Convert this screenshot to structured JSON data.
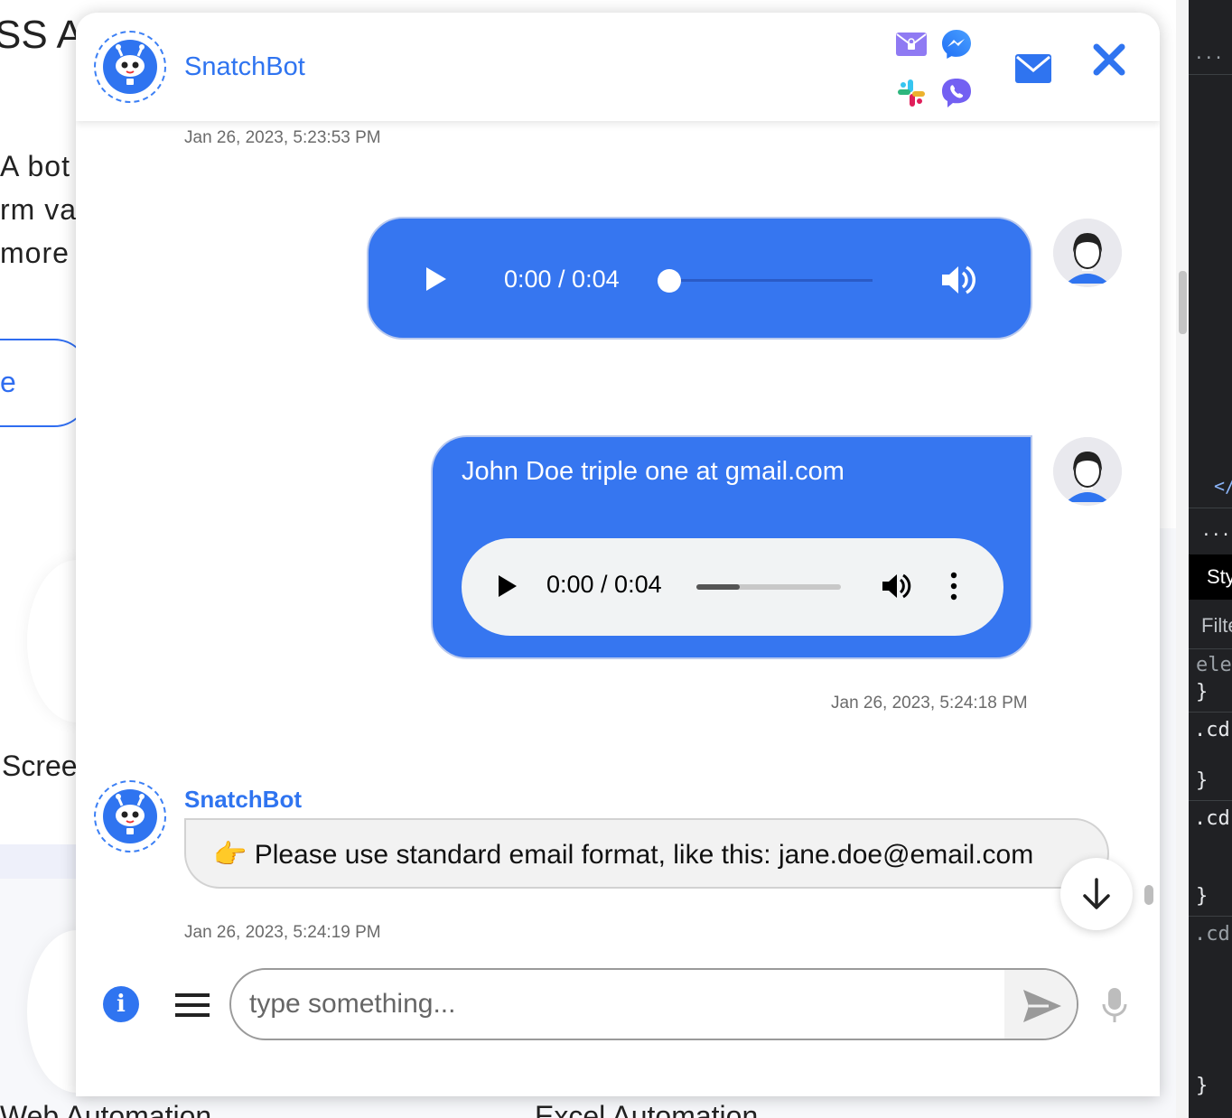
{
  "background_page": {
    "title_fragment": "SS AU",
    "lines": [
      "A bot",
      "rm va",
      " more"
    ],
    "button_fragment": "e",
    "screen_fragment": "Scree",
    "bottom_left": "Web Automation",
    "bottom_right": "Excel Automation"
  },
  "devtools": {
    "dots_top": "···",
    "close_tag": "</",
    "dots_mid": "···",
    "tab_label": "Sty",
    "filter_label": "Filte",
    "lines": [
      "ele",
      "}",
      ".cd",
      "}",
      ".cd",
      "}",
      ".cd",
      "}"
    ]
  },
  "chat": {
    "header": {
      "bot_name": "SnatchBot",
      "channel_icons": [
        "secure-mail-icon",
        "messenger-icon",
        "slack-icon",
        "viber-icon"
      ],
      "email_icon": "envelope-icon",
      "close_icon": "close-icon"
    },
    "timestamps": {
      "first": "Jan 26, 2023, 5:23:53 PM",
      "user_second": "Jan 26, 2023, 5:24:18 PM",
      "bot_reply": "Jan 26, 2023, 5:24:19 PM"
    },
    "user_audio_message": {
      "time": "0:00 / 0:04",
      "progress": 0
    },
    "user_text_message": {
      "text": "John Doe triple one at gmail.com",
      "audio_time": "0:00 / 0:04",
      "progress": 0.3
    },
    "bot_message": {
      "sender": "SnatchBot",
      "text": "👉 Please use standard email format, like this: jane.doe@email.com"
    },
    "composer": {
      "placeholder": "type something...",
      "value": ""
    },
    "colors": {
      "accent": "#2f74f0",
      "user_bubble": "#3676f0",
      "bot_bubble": "#f2f2f2",
      "close": "#2f74f0"
    }
  }
}
